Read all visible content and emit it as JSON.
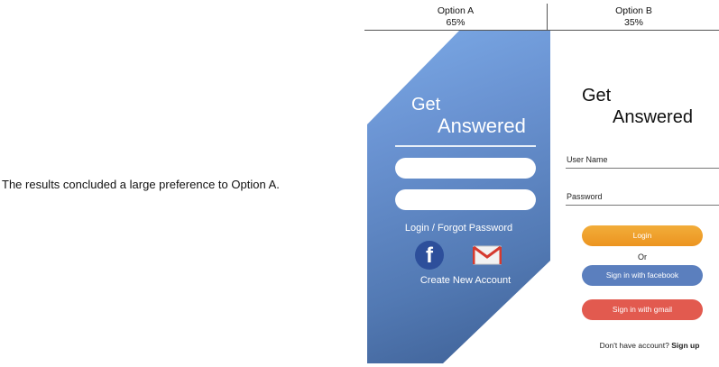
{
  "conclusion": "The results concluded a large preference to Option A.",
  "columns": [
    {
      "name": "Option A",
      "percent": "65%"
    },
    {
      "name": "Option B",
      "percent": "35%"
    }
  ],
  "option_a": {
    "title_line1": "Get",
    "title_line2": "Answered",
    "login_link": "Login / Forgot Password",
    "create_account": "Create New Account",
    "facebook_glyph": "f",
    "icons": [
      "facebook-icon",
      "gmail-icon"
    ],
    "colors": {
      "gradient_top": "#7ba9e6",
      "gradient_bottom": "#3d5f94"
    }
  },
  "option_b": {
    "title_line1": "Get",
    "title_line2": "Answered",
    "username_label": "User Name",
    "password_label": "Password",
    "login_button": "Login",
    "or_text": "Or",
    "facebook_button": "Sign in with facebook",
    "gmail_button": "Sign in with gmail",
    "signup_prompt": "Don't have account?",
    "signup_link": "Sign up",
    "colors": {
      "login": "#f0a22c",
      "facebook": "#5b7fbe",
      "gmail": "#e25a4f"
    }
  }
}
